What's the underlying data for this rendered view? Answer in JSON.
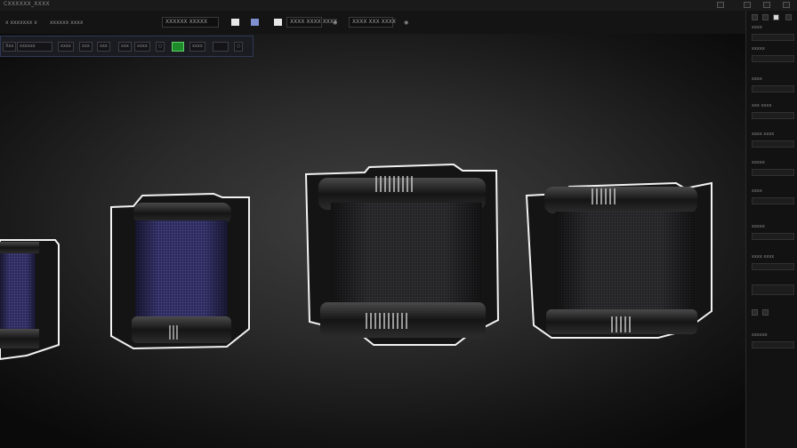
{
  "titlebar": {
    "title": "CXXXXXX_XXXX"
  },
  "toolbar": {
    "item_1": "x  xxxxxxx  x",
    "item_2": "xxxxxx  xxxx",
    "field_1": "XXXXXX  XXXXX",
    "field_2": "XXXX  XXXX  XXXX",
    "field_3": "XXXX  XXX  XXXX"
  },
  "toolbar_secondary": {
    "items": [
      "Xxx",
      "xxxxxx",
      "xxxx",
      "xxx",
      "xxx",
      "xxx",
      "xxxx",
      "xxxx"
    ]
  },
  "right_panel": {
    "labels": [
      "xxxx",
      "xxxxx",
      "xxxx",
      "xxx xxxx",
      "xxxx xxxx",
      "xxxxx",
      "xxxx",
      "xxxxx",
      "xxxx xxxx",
      "xxxxxx"
    ]
  },
  "colors": {
    "blue_mesh": "#3b3970",
    "dark_mesh": "#2e2e31",
    "outline": "#f2f2f2",
    "selection_green": "#1f8a2a"
  }
}
